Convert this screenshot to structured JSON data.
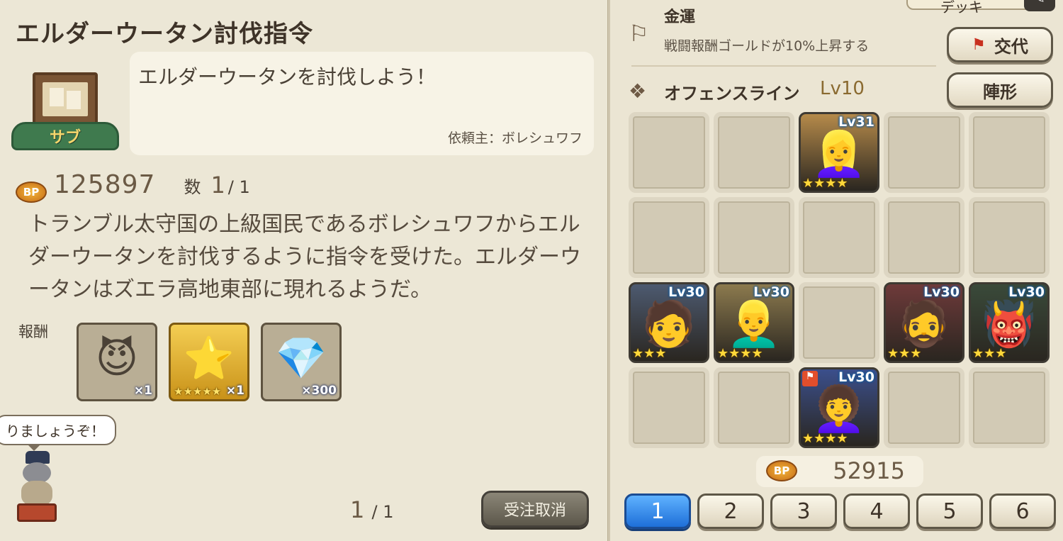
{
  "quest": {
    "title": "エルダーウータン討伐指令",
    "tag": "サブ",
    "request_text": "エルダーウータンを討伐しよう！",
    "client": "依頼主：ボレシュワフ",
    "bp_badge": "BP",
    "bp_value": "125897",
    "count_label": "数",
    "count_current": "1",
    "count_total": "/ 1",
    "description": "トランブル太守国の上級国民であるボレシュワフからエルダーウータンを討伐するように指令を受けた。エルダーウータンはズエラ高地東部に現れるようだ。",
    "reward_label": "報酬",
    "rewards": [
      {
        "icon": "demon-emblem-icon",
        "glyph": "😈",
        "stars": "",
        "qty": "×1"
      },
      {
        "icon": "star-crystal-icon",
        "glyph": "⭐",
        "stars": "★★★★★",
        "qty": "×1"
      },
      {
        "icon": "rainbow-gem-icon",
        "glyph": "💎",
        "stars": "",
        "qty": "×300"
      }
    ],
    "speech": "りましょうぞ！",
    "page_current": "1",
    "page_total": "/ 1",
    "cancel_label": "受注取消"
  },
  "party": {
    "top_tab_label": "デッキ",
    "skill_name": "金運",
    "skill_desc": "戦闘報酬ゴールドが10%上昇する",
    "swap_label": "交代",
    "formation_label": "陣形",
    "line_name": "オフェンスライン",
    "line_level": "Lv10",
    "bp_badge": "BP",
    "bp_value": "52915",
    "tabs": [
      "1",
      "2",
      "3",
      "4",
      "5",
      "6"
    ],
    "active_tab": "1",
    "units": {
      "r0c2": {
        "level": "Lv31",
        "stars": "★★★★",
        "face": "👱‍♀️",
        "bg": "#b58a4a"
      },
      "r2c0": {
        "level": "Lv30",
        "stars": "★★★",
        "face": "🧑",
        "bg": "#4d5a70"
      },
      "r2c1": {
        "level": "Lv30",
        "stars": "★★★★",
        "face": "👱‍♂️",
        "bg": "#8c7a4e"
      },
      "r2c3": {
        "level": "Lv30",
        "stars": "★★★",
        "face": "🧔",
        "bg": "#6e3a3a"
      },
      "r2c4": {
        "level": "Lv30",
        "stars": "★★★",
        "face": "👹",
        "bg": "#3a4a3a"
      },
      "r3c2": {
        "level": "Lv30",
        "stars": "★★★★",
        "face": "👩‍🦱",
        "bg": "#3b4f8c"
      }
    }
  }
}
